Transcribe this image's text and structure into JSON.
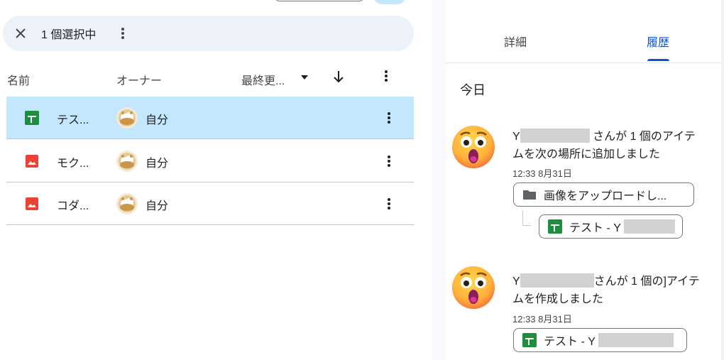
{
  "selection": {
    "count_label": "1 個選択中"
  },
  "list_header": {
    "name": "名前",
    "owner": "オーナー",
    "modified": "最終更..."
  },
  "files": [
    {
      "name": "テス...",
      "type": "sheets",
      "owner": "自分",
      "selected": true
    },
    {
      "name": "モク...",
      "type": "image",
      "owner": "自分",
      "selected": false
    },
    {
      "name": "コダ...",
      "type": "image",
      "owner": "自分",
      "selected": false
    }
  ],
  "panel": {
    "tabs": [
      {
        "label": "詳細",
        "active": false
      },
      {
        "label": "履歴",
        "active": true
      }
    ],
    "section_label": "今日",
    "activities": [
      {
        "user_initial": "Y",
        "text_line1": " さんが 1 個のアイテ",
        "text_line2": "ムを次の場所に追加しました",
        "time": "12:33 8月31日",
        "folder": "画像をアップロードし...",
        "item": "テスト - Y"
      },
      {
        "user_initial": "Y",
        "text_line1": "さんが 1 個の]アイテ",
        "text_line2": "ムを作成しました",
        "time": "12:33 8月31日",
        "item": "テスト - Y"
      }
    ]
  },
  "colors": {
    "accent": "#0b57d0",
    "selected_row": "#c2e7ff",
    "selection_bar": "#edf2fa",
    "sheets_green": "#1e8e3e",
    "image_red": "#ea4335"
  }
}
